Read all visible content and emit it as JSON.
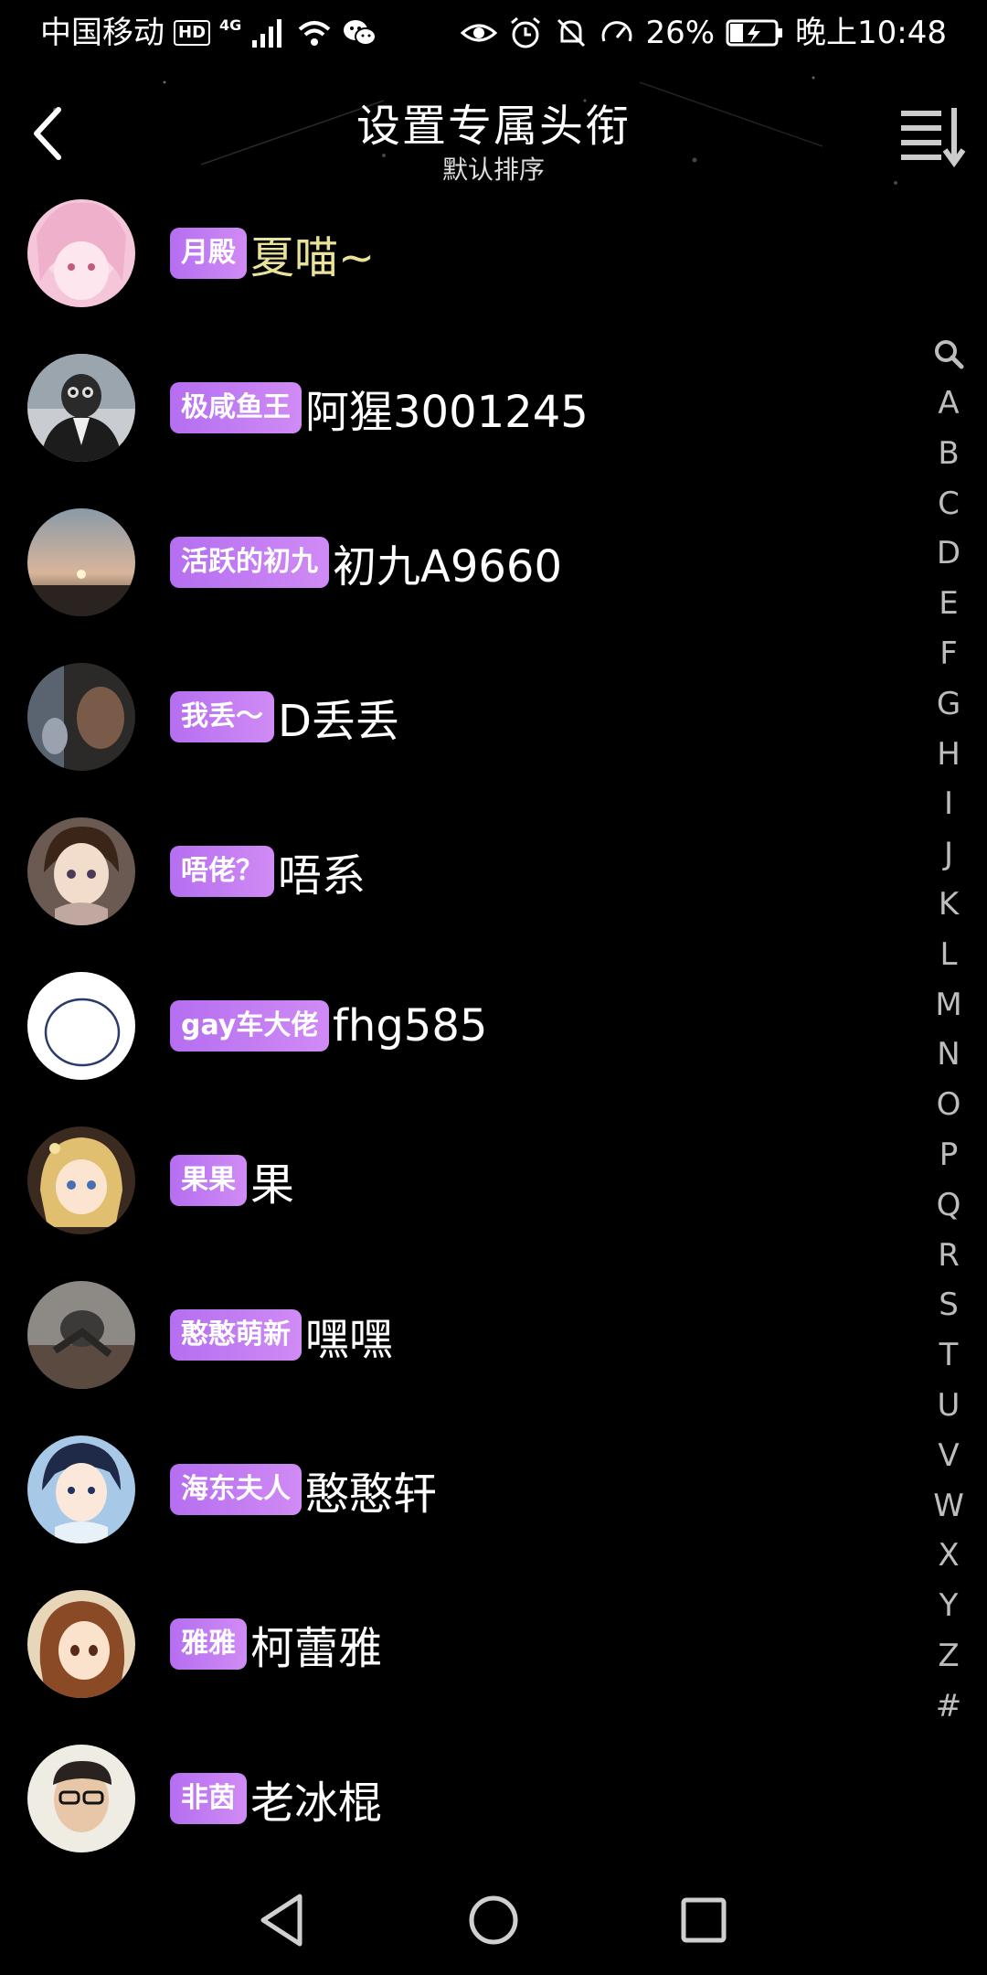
{
  "status_bar": {
    "carrier": "中国移动",
    "hd": "HD",
    "network": "4G",
    "battery": "26%",
    "time": "晚上10:48"
  },
  "header": {
    "title": "设置专属头衔",
    "subtitle": "默认排序",
    "back_icon": "chevron-left-icon",
    "sort_icon": "sort-list-icon"
  },
  "contacts": [
    {
      "badge": "月殿",
      "name": "夏喵~",
      "avatar": "pink-anime-avatar"
    },
    {
      "badge": "极咸鱼王",
      "name": "阿猩3001245",
      "avatar": "gorilla-suit-avatar"
    },
    {
      "badge": "活跃的初九",
      "name": "初九A9660",
      "avatar": "sunset-avatar"
    },
    {
      "badge": "我丢～",
      "name": "D丢丢",
      "avatar": "dark-photo-avatar"
    },
    {
      "badge": "唔佬？",
      "name": "唔系",
      "avatar": "anime-boy-avatar"
    },
    {
      "badge": "gay车大佬",
      "name": "fhg585",
      "avatar": "white-circle-avatar"
    },
    {
      "badge": "果果",
      "name": "果",
      "avatar": "anime-girl-avatar"
    },
    {
      "badge": "憨憨萌新",
      "name": "嘿嘿",
      "avatar": "runner-avatar"
    },
    {
      "badge": "海东夫人",
      "name": "憨憨轩",
      "avatar": "anime-man-avatar"
    },
    {
      "badge": "雅雅",
      "name": "柯蕾雅",
      "avatar": "takagi-avatar"
    },
    {
      "badge": "非茵",
      "name": "老冰棍",
      "avatar": "glasses-man-avatar"
    }
  ],
  "alphabet": [
    "A",
    "B",
    "C",
    "D",
    "E",
    "F",
    "G",
    "H",
    "I",
    "J",
    "K",
    "L",
    "M",
    "N",
    "O",
    "P",
    "Q",
    "R",
    "S",
    "T",
    "U",
    "V",
    "W",
    "X",
    "Y",
    "Z",
    "#"
  ],
  "colors": {
    "background": "#000000",
    "badge_gradient_start": "#b56ef0",
    "badge_gradient_end": "#d08bf5",
    "index_letter": "#bdbdbd"
  },
  "nav": {
    "back_icon": "triangle-back-icon",
    "home_icon": "circle-home-icon",
    "recents_icon": "square-recents-icon"
  }
}
